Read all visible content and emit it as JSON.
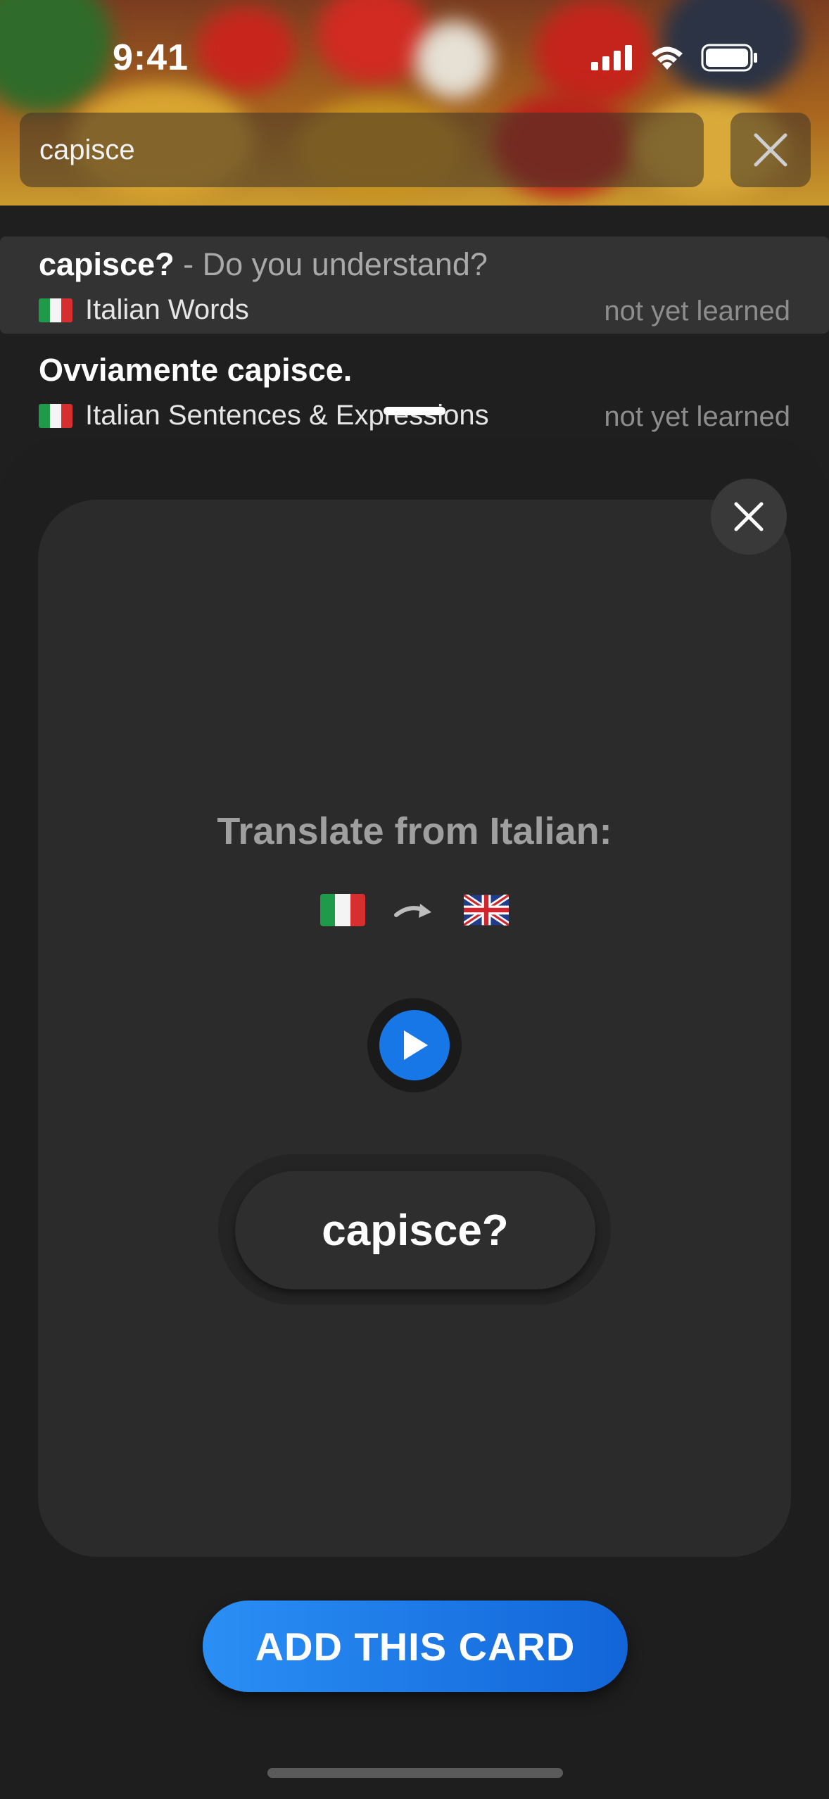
{
  "status_bar": {
    "time": "9:41"
  },
  "search": {
    "value": "capisce",
    "clear_icon": "close-icon"
  },
  "results": [
    {
      "title": "capisce?",
      "separator": " - ",
      "translation": "Do you understand?",
      "deck": "Italian Words",
      "status": "not yet learned"
    },
    {
      "title": "Ovviamente capisce.",
      "deck": "Italian Sentences & Expressions",
      "status": "not yet learned"
    }
  ],
  "card": {
    "prompt": "Translate from Italian:",
    "from_flag": "italy-flag",
    "to_flag": "uk-flag",
    "word": "capisce?"
  },
  "add_button": {
    "label": "ADD THIS CARD"
  },
  "colors": {
    "accent": "#1877e6",
    "background": "#1f1f1f",
    "card": "#2b2b2b"
  }
}
